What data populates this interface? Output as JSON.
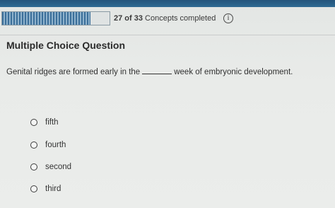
{
  "progress": {
    "completed": 27,
    "total": 33,
    "fraction": 0.82,
    "count_text": "27 of 33",
    "suffix_text": "Concepts completed"
  },
  "info_icon": "info-icon",
  "question": {
    "type_label": "Multiple Choice Question",
    "prompt_before": "Genital ridges are formed early in the",
    "prompt_after": "week of embryonic development."
  },
  "options": [
    "fifth",
    "fourth",
    "second",
    "third"
  ],
  "colors": {
    "top_bar": "#2f6a93",
    "progress_fill": "#3b6f9a",
    "background": "#e9ebe9"
  }
}
